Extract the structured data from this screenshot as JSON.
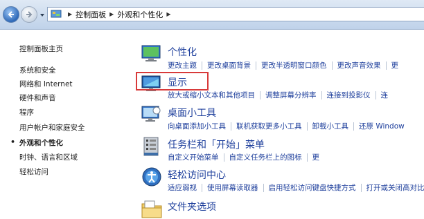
{
  "breadcrumb": {
    "items": [
      "控制面板",
      "外观和个性化"
    ]
  },
  "sidebar": {
    "items": [
      {
        "label": "控制面板主页"
      },
      {
        "label": "系统和安全"
      },
      {
        "label": "网络和 Internet"
      },
      {
        "label": "硬件和声音"
      },
      {
        "label": "程序"
      },
      {
        "label": "用户帐户和家庭安全"
      },
      {
        "label": "外观和个性化",
        "current": true
      },
      {
        "label": "时钟、语言和区域"
      },
      {
        "label": "轻松访问"
      }
    ]
  },
  "categories": [
    {
      "title": "个性化",
      "icon": "personalization-icon",
      "links": [
        "更改主题",
        "更改桌面背景",
        "更改半透明窗口颜色",
        "更改声音效果",
        "更"
      ]
    },
    {
      "title": "显示",
      "icon": "display-icon",
      "links": [
        "放大或缩小文本和其他项目",
        "调整屏幕分辨率",
        "连接到投影仪",
        "连"
      ]
    },
    {
      "title": "桌面小工具",
      "icon": "gadgets-icon",
      "links": [
        "向桌面添加小工具",
        "联机获取更多小工具",
        "卸载小工具",
        "还原 Window"
      ]
    },
    {
      "title": "任务栏和「开始」菜单",
      "icon": "taskbar-icon",
      "links": [
        "自定义开始菜单",
        "自定义任务栏上的图标",
        "更"
      ]
    },
    {
      "title": "轻松访问中心",
      "icon": "ease-of-access-icon",
      "links": [
        "适应弱视",
        "使用屏幕读取器",
        "启用轻松访问键盘快捷方式",
        "打开或关闭高对比度"
      ]
    },
    {
      "title": "文件夹选项",
      "icon": "folder-options-icon",
      "links": []
    }
  ],
  "colors": {
    "link": "#1e3f9c",
    "highlight_box": "#d83a3a"
  }
}
